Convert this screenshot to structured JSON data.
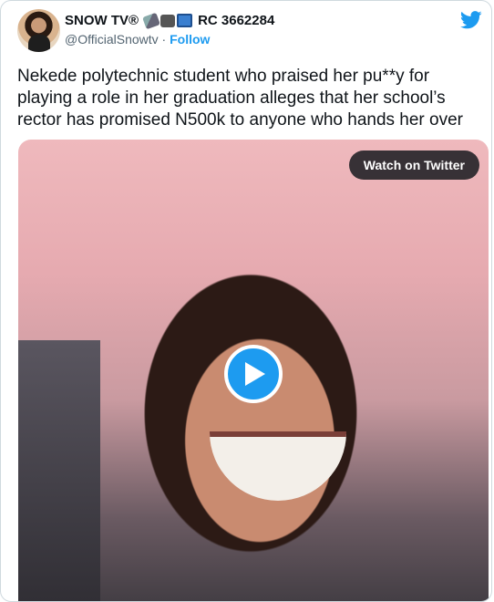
{
  "author": {
    "display_name": "SNOW TV®",
    "registration": "RC 3662284",
    "handle": "@OfficialSnowtv",
    "separator": "·",
    "follow_label": "Follow",
    "emoji_icons": [
      "satellite-antenna-icon",
      "movie-camera-icon",
      "television-icon"
    ]
  },
  "tweet": {
    "text": "Nekede polytechnic student who praised her pu**y for playing a role in her graduation alleges that her school’s rector has promised N500k to anyone who hands her over"
  },
  "media": {
    "watch_label": "Watch on Twitter",
    "play_icon": "play-icon"
  },
  "colors": {
    "accent": "#1d9bf0",
    "text": "#0f1419",
    "muted": "#536471",
    "border": "#cfd9de"
  }
}
